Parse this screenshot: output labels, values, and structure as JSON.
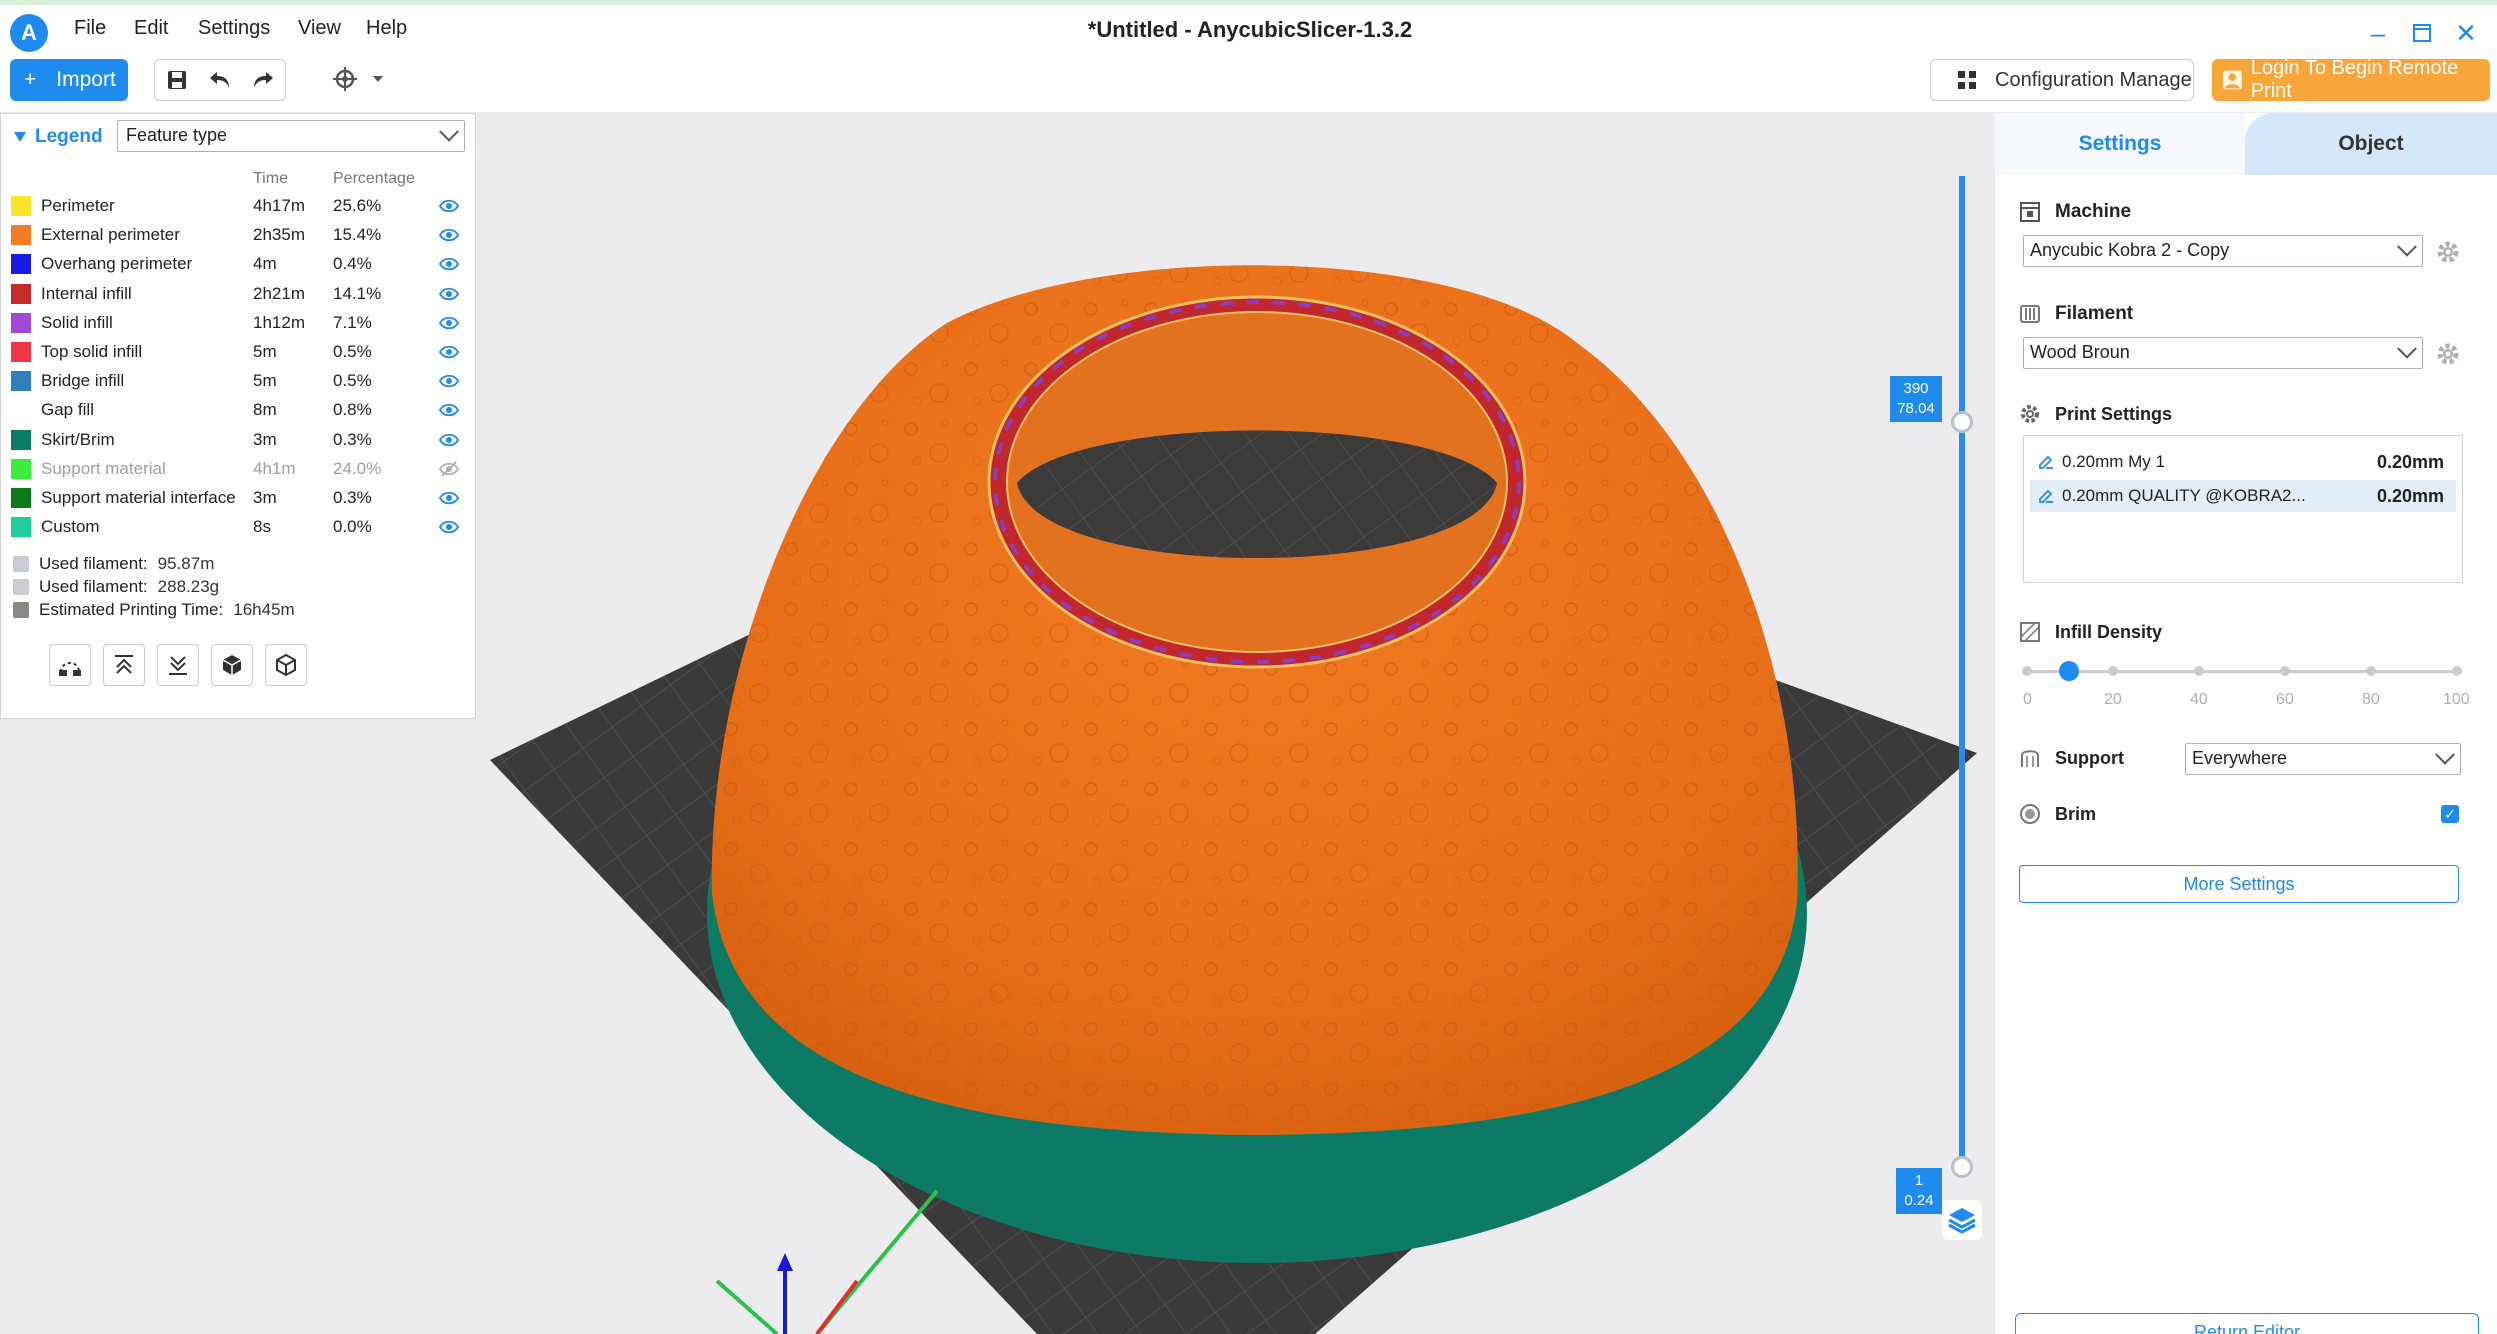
{
  "app": {
    "title": "*Untitled - AnycubicSlicer-1.3.2",
    "logo_letter": "A",
    "menus": [
      "File",
      "Edit",
      "Settings",
      "View",
      "Help"
    ]
  },
  "toolbar": {
    "import_label": "Import",
    "config_label": "Configuration Manage",
    "login_label": "Login To Begin Remote Print"
  },
  "legend": {
    "title": "Legend",
    "selector": "Feature type",
    "col_time": "Time",
    "col_pct": "Percentage",
    "rows": [
      {
        "name": "Perimeter",
        "time": "4h17m",
        "pct": "25.6%",
        "color": "#ffe52a",
        "visible": true
      },
      {
        "name": "External perimeter",
        "time": "2h35m",
        "pct": "15.4%",
        "color": "#f27d22",
        "visible": true
      },
      {
        "name": "Overhang perimeter",
        "time": "4m",
        "pct": "0.4%",
        "color": "#1a1ae6",
        "visible": true
      },
      {
        "name": "Internal infill",
        "time": "2h21m",
        "pct": "14.1%",
        "color": "#c62b2b",
        "visible": true
      },
      {
        "name": "Solid infill",
        "time": "1h12m",
        "pct": "7.1%",
        "color": "#a04ad6",
        "visible": true
      },
      {
        "name": "Top solid infill",
        "time": "5m",
        "pct": "0.5%",
        "color": "#f0374a",
        "visible": true
      },
      {
        "name": "Bridge infill",
        "time": "5m",
        "pct": "0.5%",
        "color": "#2f7fbf",
        "visible": true
      },
      {
        "name": "Gap fill",
        "time": "8m",
        "pct": "0.8%",
        "color": "#ffffff",
        "visible": true
      },
      {
        "name": "Skirt/Brim",
        "time": "3m",
        "pct": "0.3%",
        "color": "#0d7a66",
        "visible": true
      },
      {
        "name": "Support material",
        "time": "4h1m",
        "pct": "24.0%",
        "color": "#3cee3c",
        "visible": false
      },
      {
        "name": "Support material interface",
        "time": "3m",
        "pct": "0.3%",
        "color": "#0f7a1a",
        "visible": true
      },
      {
        "name": "Custom",
        "time": "8s",
        "pct": "0.0%",
        "color": "#1fcc9a",
        "visible": true
      }
    ],
    "stats": [
      {
        "label": "Used filament:",
        "value": "95.87m"
      },
      {
        "label": "Used filament:",
        "value": "288.23g"
      },
      {
        "label": "Estimated Printing Time:",
        "value": "16h45m"
      }
    ]
  },
  "viewport": {
    "layer_top": {
      "layer": "390",
      "height": "78.04"
    },
    "layer_bottom": {
      "layer": "1",
      "height": "0.24"
    }
  },
  "panel": {
    "tabs": [
      "Settings",
      "Object"
    ],
    "machine_label": "Machine",
    "machine_value": "Anycubic Kobra 2 - Copy",
    "filament_label": "Filament",
    "filament_value": "Wood Broun",
    "print_label": "Print Settings",
    "print_items": [
      {
        "name": "0.20mm My 1",
        "value": "0.20mm",
        "selected": false
      },
      {
        "name": "0.20mm QUALITY @KOBRA2...",
        "value": "0.20mm",
        "selected": true
      }
    ],
    "infill_label": "Infill Density",
    "infill_value": 10,
    "infill_ticks": [
      "0",
      "20",
      "40",
      "60",
      "80",
      "100"
    ],
    "support_label": "Support",
    "support_value": "Everywhere",
    "brim_label": "Brim",
    "brim_checked": true,
    "more_settings": "More Settings",
    "return_editor": "Return Editor"
  }
}
